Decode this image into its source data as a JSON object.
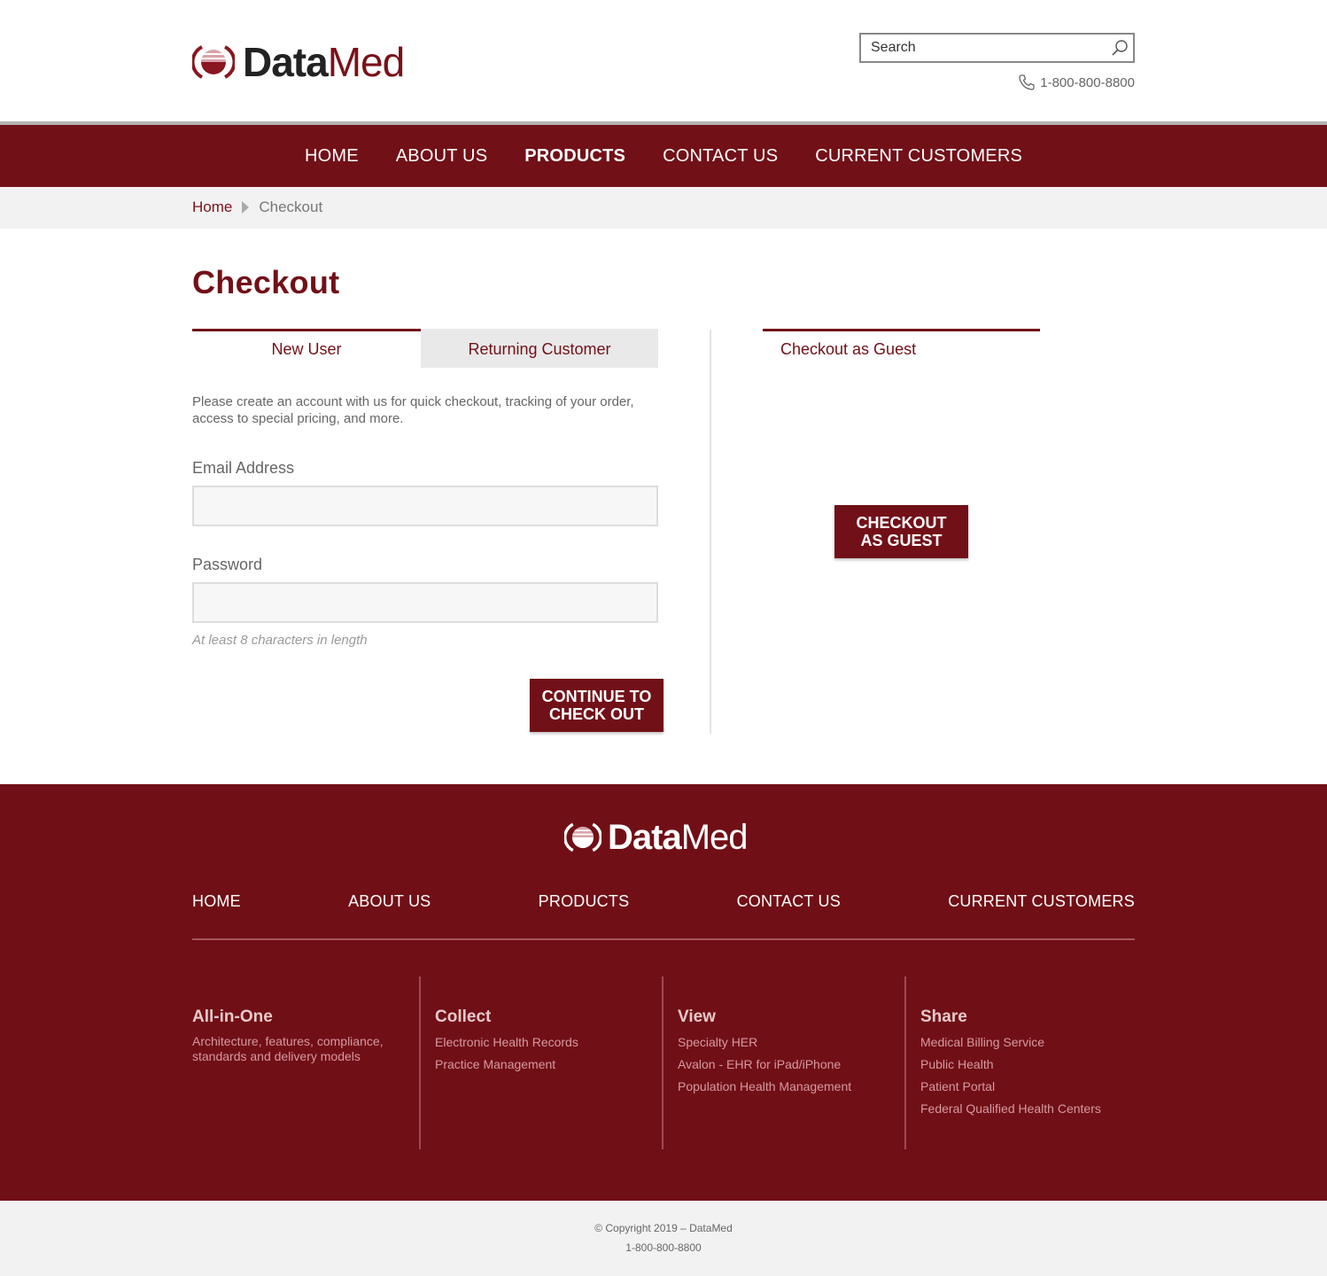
{
  "brand": {
    "name_bold": "Data",
    "name_light": "Med",
    "accent": "#721018"
  },
  "header": {
    "search_placeholder": "Search",
    "phone": "1-800-800-8800"
  },
  "nav": [
    {
      "label": "HOME",
      "active": false
    },
    {
      "label": "ABOUT US",
      "active": false
    },
    {
      "label": "PRODUCTS",
      "active": true
    },
    {
      "label": "CONTACT US",
      "active": false
    },
    {
      "label": "CURRENT CUSTOMERS",
      "active": false
    }
  ],
  "breadcrumb": {
    "home": "Home",
    "current": "Checkout"
  },
  "main": {
    "title": "Checkout",
    "tabs": {
      "new_user": "New User",
      "returning": "Returning Customer"
    },
    "intro": "Please create an account with us for quick checkout, tracking of your order, access to special pricing, and more.",
    "email_label": "Email Address",
    "email_value": "",
    "password_label": "Password",
    "password_value": "",
    "password_hint": "At least 8 characters in length",
    "continue_line1": "CONTINUE TO",
    "continue_line2": "CHECK OUT",
    "guest_heading": "Checkout as Guest",
    "guest_line1": "CHECKOUT",
    "guest_line2": "AS GUEST"
  },
  "footer": {
    "nav": [
      "HOME",
      "ABOUT US",
      "PRODUCTS",
      "CONTACT US",
      "CURRENT CUSTOMERS"
    ],
    "columns": [
      {
        "title": "All-in-One",
        "desc": "Architecture, features, compliance, standards and delivery models"
      },
      {
        "title": "Collect",
        "links": [
          "Electronic Health Records",
          "Practice Management"
        ]
      },
      {
        "title": "View",
        "links": [
          "Specialty HER",
          "Avalon - EHR for iPad/iPhone",
          "Population Health Management"
        ]
      },
      {
        "title": "Share",
        "links": [
          "Medical Billing Service",
          "Public Health",
          "Patient Portal",
          "Federal Qualified Health Centers"
        ]
      }
    ],
    "copyright": "© Copyright 2019 – DataMed",
    "phone": "1-800-800-8800"
  }
}
